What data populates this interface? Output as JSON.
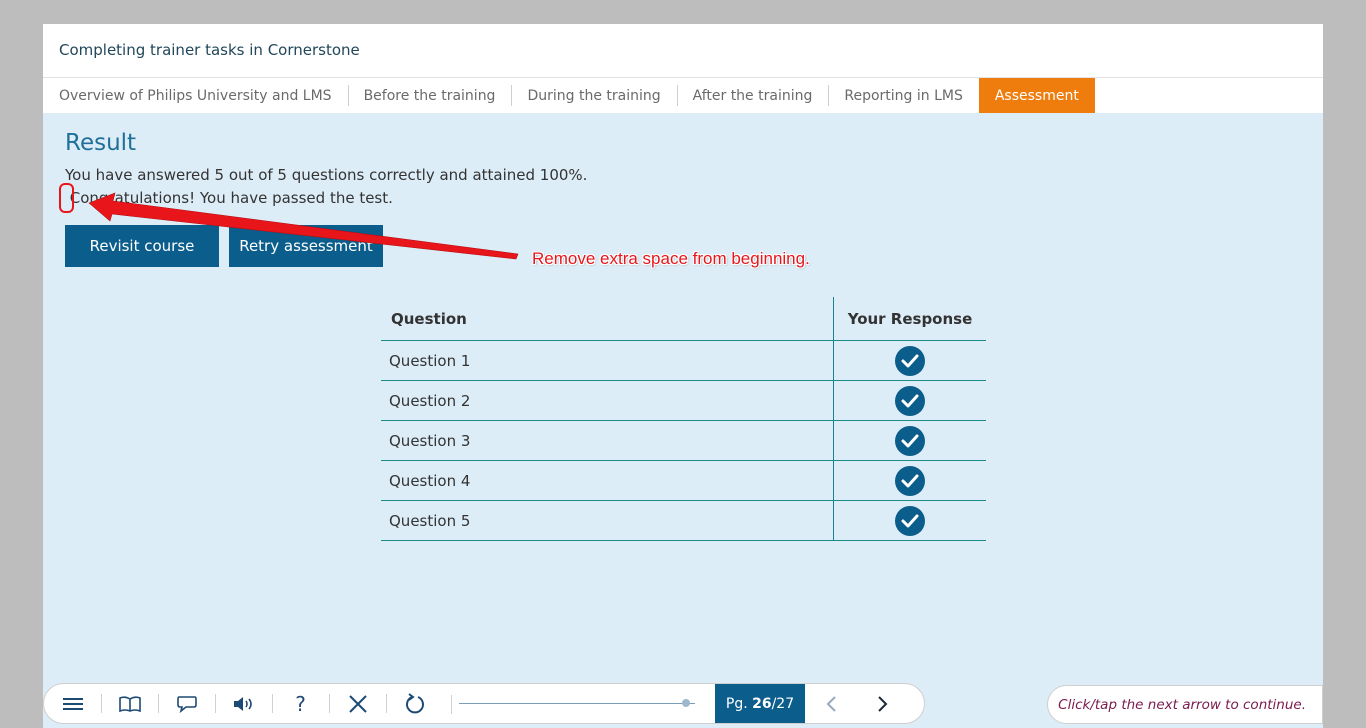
{
  "course": {
    "title": "Completing trainer tasks in Cornerstone"
  },
  "tabs": [
    {
      "label": "Overview of Philips University and LMS"
    },
    {
      "label": "Before the training"
    },
    {
      "label": "During the training"
    },
    {
      "label": "After the training"
    },
    {
      "label": "Reporting in LMS"
    },
    {
      "label": "Assessment",
      "active": true
    }
  ],
  "result": {
    "heading": "Result",
    "line1": "You have answered 5 out of 5 questions correctly and attained 100%.",
    "line2": " Congratulations! You have passed the test.",
    "revisit_label": "Revisit course",
    "retry_label": "Retry assessment"
  },
  "table": {
    "header_question": "Question",
    "header_response": "Your Response",
    "rows": [
      {
        "question": "Question 1",
        "correct": true
      },
      {
        "question": "Question 2",
        "correct": true
      },
      {
        "question": "Question 3",
        "correct": true
      },
      {
        "question": "Question 4",
        "correct": true
      },
      {
        "question": "Question 5",
        "correct": true
      }
    ]
  },
  "annotation": {
    "text": "Remove extra space from beginning.",
    "color": "#e8161b"
  },
  "toolbar": {
    "icons": [
      "menu-icon",
      "book-icon",
      "speech-bubble-icon",
      "volume-icon",
      "help-icon",
      "close-icon",
      "refresh-icon"
    ],
    "help_glyph": "?",
    "page_prefix": "Pg. ",
    "page_current": "26",
    "page_total": "/27",
    "progress": 0.963
  },
  "hint": {
    "text": "Click/tap the next arrow to continue."
  },
  "colors": {
    "accent": "#ee7d0e",
    "primary": "#0b5d8c",
    "background": "#ddedf7"
  }
}
